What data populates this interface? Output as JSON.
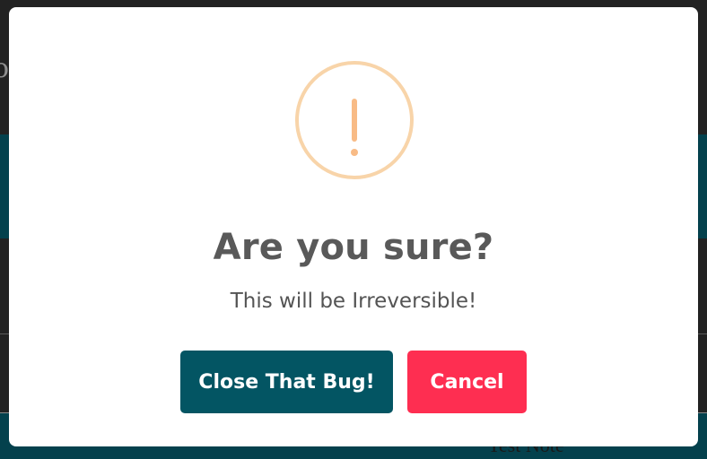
{
  "background": {
    "partial_text_left": "o",
    "partial_text_bottom": "Test Note"
  },
  "modal": {
    "icon": "exclamation-warning-icon",
    "title": "Are you sure?",
    "message": "This will be Irreversible!",
    "confirm_label": "Close That Bug!",
    "cancel_label": "Cancel"
  },
  "colors": {
    "icon_ring": "#f8d4a9",
    "icon_mark": "#f8bb86",
    "confirm_button": "#035563",
    "cancel_button": "#fe2e51",
    "title_text": "#595959",
    "backdrop": "#1f1f1f",
    "background_teal": "#04414d"
  }
}
